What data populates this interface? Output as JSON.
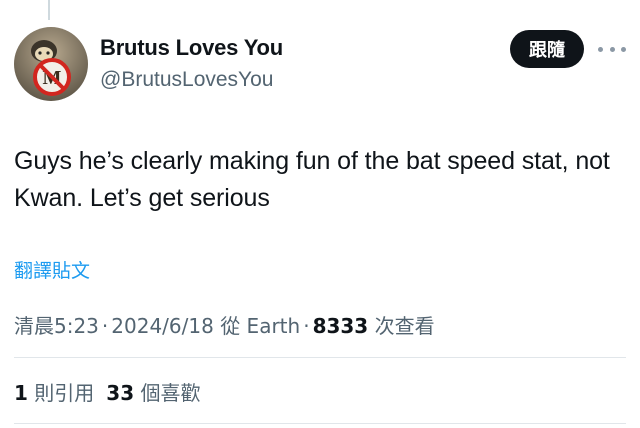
{
  "author": {
    "display_name": "Brutus Loves You",
    "handle": "@BrutusLovesYou",
    "avatar_icon": "avatar-photo-with-no-m-logo"
  },
  "actions": {
    "follow_label": "跟隨",
    "more_icon": "more-horizontal-icon"
  },
  "tweet": {
    "text": "Guys he’s clearly making fun of the bat speed stat, not Kwan. Let’s get serious",
    "translate_label": "翻譯貼文"
  },
  "meta": {
    "time": "清晨5:23",
    "separator": "·",
    "date": "2024/6/18",
    "source": "從 Earth",
    "views_count": "8333",
    "views_label": "次查看"
  },
  "engagement": {
    "quotes_count": "1",
    "quotes_label": "則引用",
    "likes_count": "33",
    "likes_label": "個喜歡"
  },
  "colors": {
    "text": "#0f1419",
    "secondary": "#536471",
    "link": "#1d9bf0",
    "follow_bg": "#0f1419"
  }
}
